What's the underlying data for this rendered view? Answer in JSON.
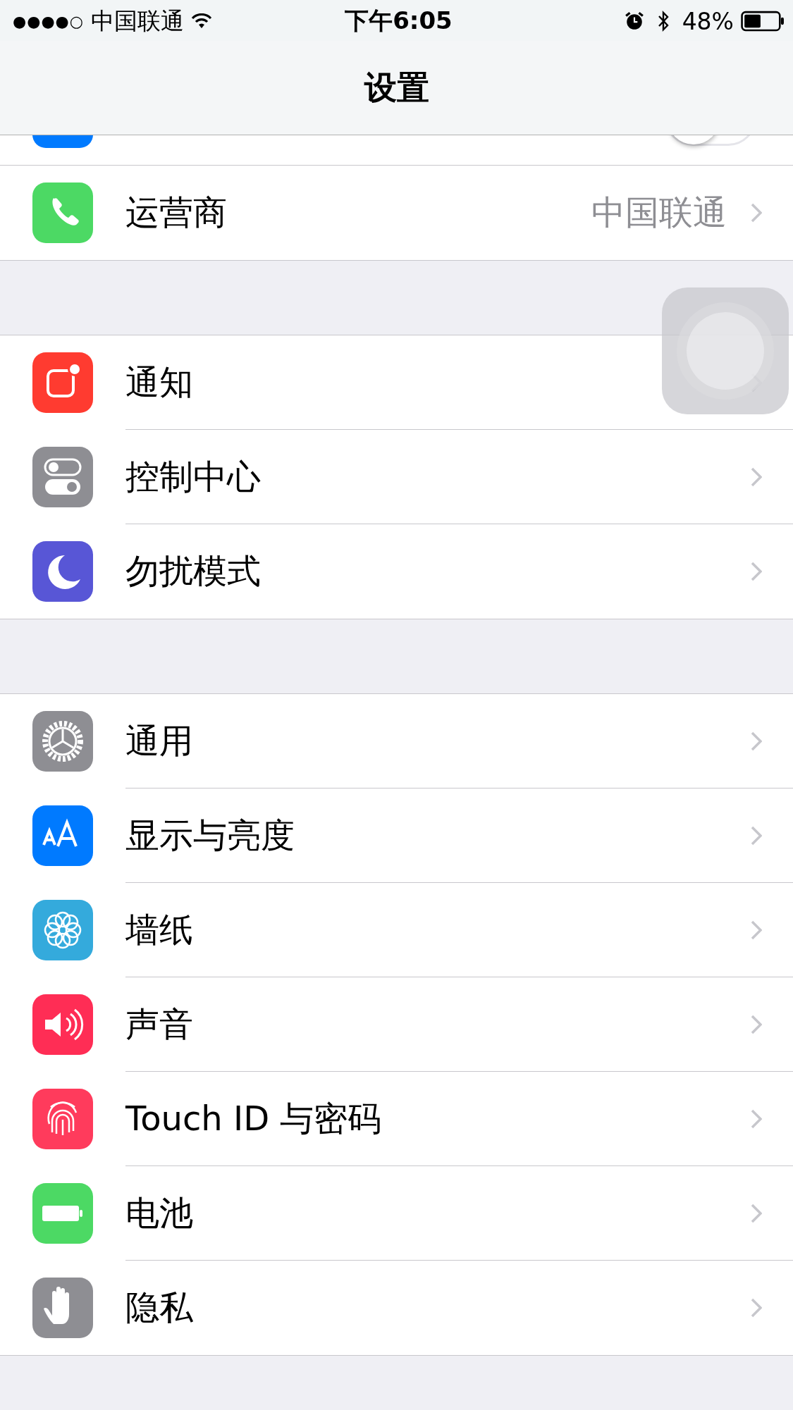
{
  "status_bar": {
    "signal": "●●●●○",
    "carrier": "中国联通",
    "time": "下午6:05",
    "battery_percent": "48%"
  },
  "nav": {
    "title": "设置"
  },
  "partial_row": {
    "kind": "toggle",
    "on": false,
    "color": "#007aff"
  },
  "groups": [
    {
      "rows": [
        {
          "label": "运营商",
          "value": "中国联通",
          "kind": "phone",
          "color": "#4cd964"
        }
      ]
    },
    {
      "rows": [
        {
          "label": "通知",
          "kind": "notifications",
          "color": "#ff3b30"
        },
        {
          "label": "控制中心",
          "kind": "switches",
          "color": "#8e8e93"
        },
        {
          "label": "勿扰模式",
          "kind": "moon",
          "color": "#5856d6"
        }
      ]
    },
    {
      "rows": [
        {
          "label": "通用",
          "kind": "gear",
          "color": "#8e8e93"
        },
        {
          "label": "显示与亮度",
          "kind": "text",
          "color": "#007aff"
        },
        {
          "label": "墙纸",
          "kind": "flower",
          "color": "#34aadc"
        },
        {
          "label": "声音",
          "kind": "speaker",
          "color": "#ff2d55"
        },
        {
          "label": "Touch ID 与密码",
          "kind": "fingerprint",
          "color": "#ff3b5c"
        },
        {
          "label": "电池",
          "kind": "battery",
          "color": "#4cd964"
        },
        {
          "label": "隐私",
          "kind": "hand",
          "color": "#8e8e93"
        }
      ]
    }
  ]
}
